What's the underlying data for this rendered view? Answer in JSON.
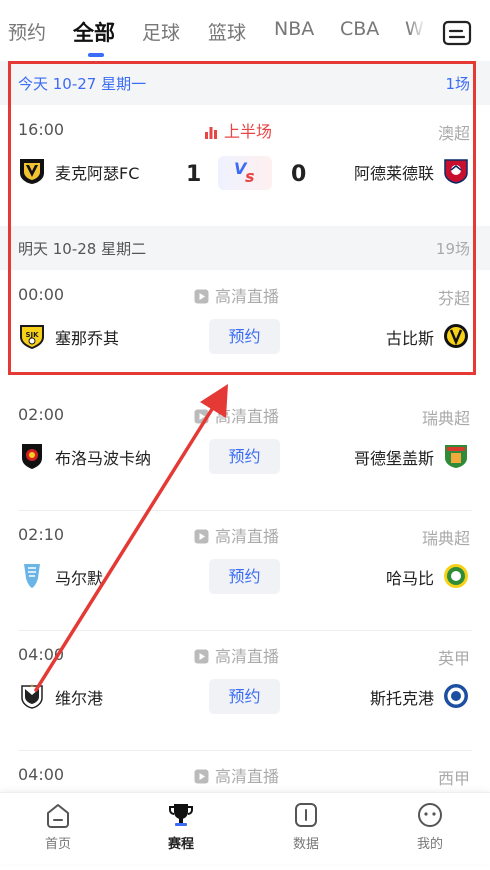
{
  "tabs": [
    "预约",
    "全部",
    "足球",
    "篮球",
    "NBA",
    "CBA",
    "W"
  ],
  "days": [
    {
      "label": "今天  10-27  星期一",
      "count": "1场"
    },
    {
      "label": "明天  10-28  星期二",
      "count": "19场"
    }
  ],
  "matches": [
    {
      "time": "16:00",
      "status": "上半场",
      "league": "澳超",
      "home": "麦克阿瑟FC",
      "away": "阿德莱德联",
      "home_score": "1",
      "away_score": "0",
      "vs_v": "V",
      "vs_s": "s"
    },
    {
      "time": "00:00",
      "status": "高清直播",
      "league": "芬超",
      "home": "塞那乔其",
      "away": "古比斯",
      "button": "预约"
    },
    {
      "time": "02:00",
      "status": "高清直播",
      "league": "瑞典超",
      "home": "布洛马波卡纳",
      "away": "哥德堡盖斯",
      "button": "预约"
    },
    {
      "time": "02:10",
      "status": "高清直播",
      "league": "瑞典超",
      "home": "马尔默",
      "away": "哈马比",
      "button": "预约"
    },
    {
      "time": "04:00",
      "status": "高清直播",
      "league": "英甲",
      "home": "维尔港",
      "away": "斯托克港",
      "button": "预约"
    },
    {
      "time": "04:00",
      "status": "高清直播",
      "league": "西甲"
    }
  ],
  "nav": [
    "首页",
    "赛程",
    "数据",
    "我的"
  ],
  "colors": {
    "accent": "#3b6cf6",
    "live": "#e84646",
    "annotation": "#e53935"
  }
}
